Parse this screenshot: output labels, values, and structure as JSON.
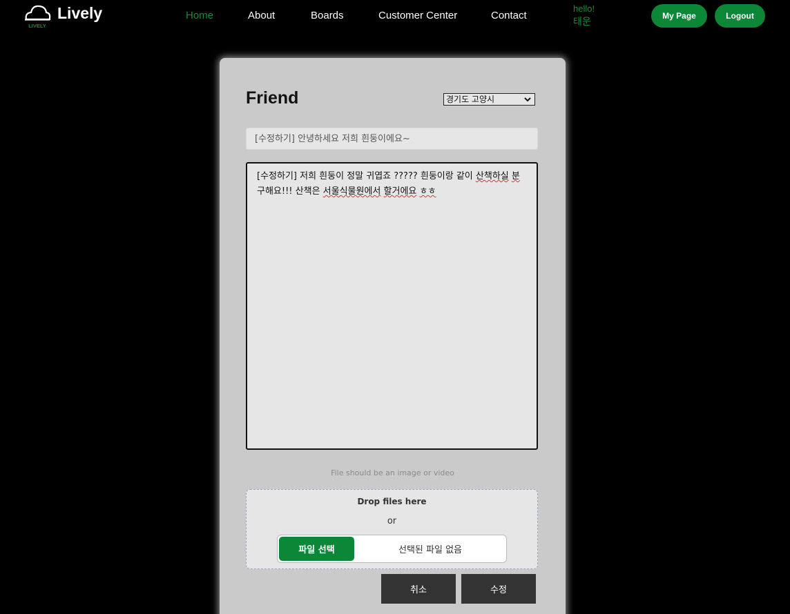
{
  "header": {
    "brand": "Lively",
    "logo_caption": "LIVELY",
    "nav": [
      {
        "label": "Home",
        "active": true
      },
      {
        "label": "About",
        "active": false
      },
      {
        "label": "Boards",
        "active": false
      },
      {
        "label": "Customer Center",
        "active": false
      },
      {
        "label": "Contact",
        "active": false
      }
    ],
    "greeting": "hello!",
    "username": "태운",
    "mypage_label": "My Page",
    "logout_label": "Logout"
  },
  "form": {
    "heading": "Friend",
    "region_selected": "경기도 고양시",
    "title_value": "[수정하기] 안녕하세요 저희 흰둥이에요~",
    "content_parts": [
      {
        "text": "[수정하기] 저희 흰둥이 정말 귀엽죠 ????? 흰둥이랑 같이 ",
        "err": false
      },
      {
        "text": "산책하실",
        "err": true
      },
      {
        "text": " ",
        "err": false
      },
      {
        "text": "분",
        "err": true
      },
      {
        "text": " 구해요!!! 산책은 ",
        "err": false
      },
      {
        "text": "서울식물원에서",
        "err": true
      },
      {
        "text": " ",
        "err": false
      },
      {
        "text": "할거에요",
        "err": true
      },
      {
        "text": " ",
        "err": false
      },
      {
        "text": "ㅎㅎ",
        "err": true
      }
    ],
    "file_hint": "File should be an image or video",
    "drop_label": "Drop files here",
    "or_label": "or",
    "file_button": "파일 선택",
    "file_none": "선택된 파일 없음",
    "cancel_label": "취소",
    "submit_label": "수정"
  },
  "colors": {
    "accent": "#0b8737",
    "active_nav": "#1a8a3a",
    "card": "#cacaca",
    "dark_button": "#333333"
  }
}
